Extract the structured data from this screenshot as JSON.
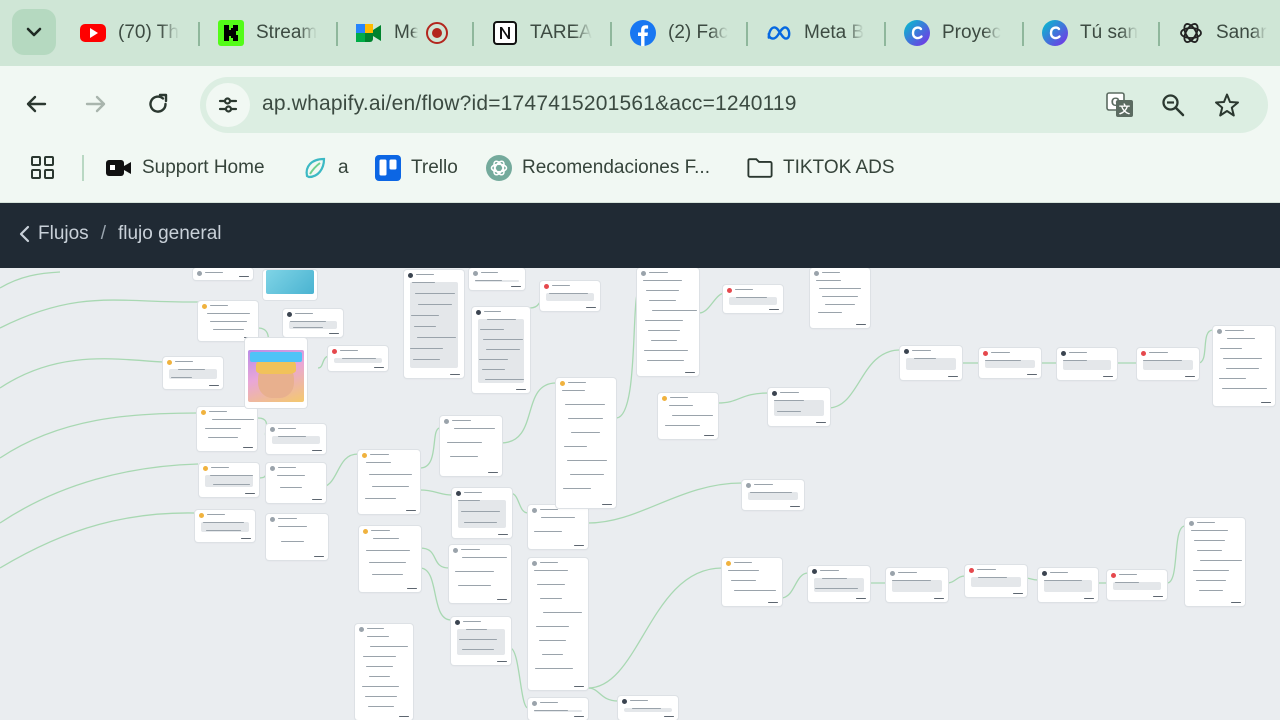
{
  "tabs": [
    {
      "label": "(70) Th",
      "icon": "youtube-icon"
    },
    {
      "label": "Stream",
      "icon": "kick-icon"
    },
    {
      "label": "Me",
      "icon": "google-meet-icon"
    },
    {
      "label": "TAREA",
      "icon": "notion-icon"
    },
    {
      "label": "(2) Fac",
      "icon": "facebook-icon"
    },
    {
      "label": "Meta B",
      "icon": "meta-icon"
    },
    {
      "label": "Proyec",
      "icon": "canva-icon"
    },
    {
      "label": "Tú san",
      "icon": "canva-icon"
    },
    {
      "label": "Sanar",
      "icon": "chatgpt-icon"
    }
  ],
  "toolbar": {
    "url": "ap.whapify.ai/en/flow?id=1747415201561&acc=1240119"
  },
  "bookmarks": [
    {
      "label": "Support Home",
      "icon": "support-icon"
    },
    {
      "label": "a",
      "icon": "leaf-icon"
    },
    {
      "label": "Trello",
      "icon": "trello-icon"
    },
    {
      "label": "Recomendaciones F...",
      "icon": "chatgpt-icon"
    },
    {
      "label": "TIKTOK ADS",
      "icon": "folder-icon"
    }
  ],
  "breadcrumb": {
    "parent": "Flujos",
    "separator": "/",
    "current": "flujo general"
  },
  "colors": {
    "tab_strip": "#cfe6d6",
    "toolbar": "#f1f8f3",
    "header": "#202a34",
    "canvas": "#eaedf0",
    "edge": "#8fd19e"
  }
}
